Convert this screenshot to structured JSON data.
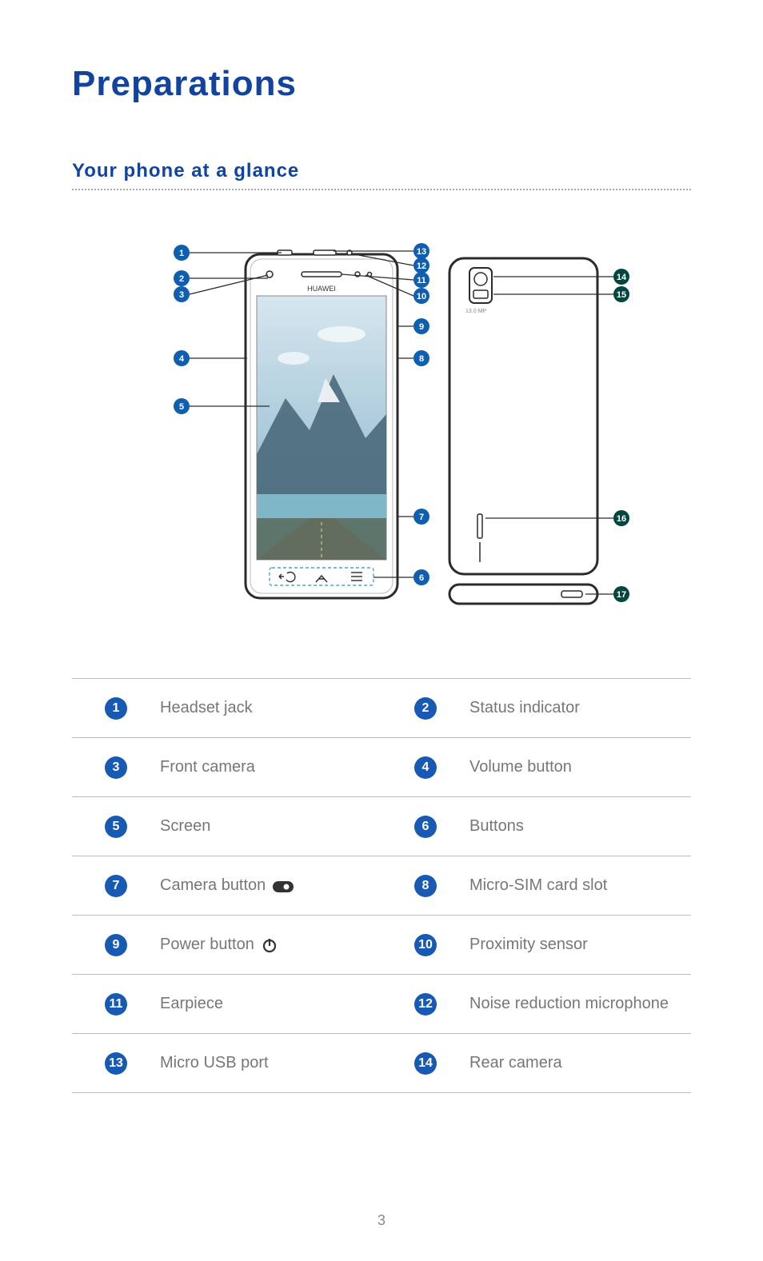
{
  "title": "Preparations",
  "subtitle": "Your phone at a glance",
  "pageNumber": "3",
  "diagram": {
    "brand": "HUAWEI",
    "cameraLabel": "13.0 MP",
    "callouts": [
      1,
      2,
      3,
      4,
      5,
      6,
      7,
      8,
      9,
      10,
      11,
      12,
      13,
      14,
      15,
      16,
      17
    ]
  },
  "parts": [
    {
      "n": 1,
      "label": "Headset jack"
    },
    {
      "n": 2,
      "label": "Status indicator"
    },
    {
      "n": 3,
      "label": "Front camera"
    },
    {
      "n": 4,
      "label": "Volume button"
    },
    {
      "n": 5,
      "label": "Screen"
    },
    {
      "n": 6,
      "label": "Buttons"
    },
    {
      "n": 7,
      "label": "Camera button",
      "icon": "camera"
    },
    {
      "n": 8,
      "label": "Micro-SIM card slot"
    },
    {
      "n": 9,
      "label": "Power button",
      "icon": "power"
    },
    {
      "n": 10,
      "label": "Proximity sensor"
    },
    {
      "n": 11,
      "label": "Earpiece"
    },
    {
      "n": 12,
      "label": "Noise reduction microphone"
    },
    {
      "n": 13,
      "label": "Micro USB port"
    },
    {
      "n": 14,
      "label": "Rear camera"
    }
  ]
}
